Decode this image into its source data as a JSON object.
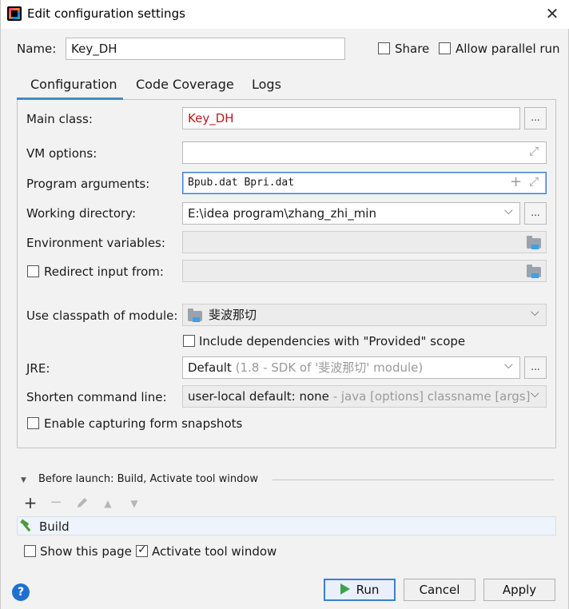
{
  "window": {
    "title": "Edit configuration settings",
    "close_glyph": "✕"
  },
  "name_row": {
    "label": "Name:",
    "value": "Key_DH",
    "share_label": "Share",
    "parallel_label": "Allow parallel run"
  },
  "tabs": [
    {
      "label": "Configuration",
      "active": true
    },
    {
      "label": "Code Coverage",
      "active": false
    },
    {
      "label": "Logs",
      "active": false
    }
  ],
  "form": {
    "main_class": {
      "label": "Main class:",
      "value": "Key_DH"
    },
    "vm_options": {
      "label": "VM options:",
      "value": ""
    },
    "program_arguments": {
      "label": "Program arguments:",
      "value": "Bpub.dat Bpri.dat"
    },
    "working_directory": {
      "label": "Working directory:",
      "value": "E:\\idea program\\zhang_zhi_min"
    },
    "environment_variables": {
      "label": "Environment variables:",
      "value": ""
    },
    "redirect_input": {
      "label": "Redirect input from:",
      "value": ""
    },
    "classpath_module": {
      "label": "Use classpath of module:",
      "value": "斐波那切"
    },
    "include_provided": {
      "label": "Include dependencies with \"Provided\" scope"
    },
    "jre": {
      "label": "JRE:",
      "value": "Default",
      "hint": "(1.8 - SDK of '斐波那切' module)"
    },
    "shorten": {
      "label": "Shorten command line:",
      "value": "user-local default: none",
      "hint": " - java [options] classname [args]"
    },
    "capture_snapshots": {
      "label": "Enable capturing form snapshots"
    }
  },
  "before_launch": {
    "header": "Before launch: Build, Activate tool window",
    "items": [
      {
        "label": "Build"
      }
    ],
    "show_page_label": "Show this page",
    "activate_label": "Activate tool window"
  },
  "buttons": {
    "run": "Run",
    "cancel": "Cancel",
    "apply": "Apply",
    "help": "?",
    "dots": "..."
  },
  "glyphs": {
    "plus": "+",
    "minus": "−",
    "up": "▲",
    "down": "▼",
    "expand": "⤢",
    "chevron": "⌵",
    "triangle": "▼"
  },
  "colors": {
    "accent": "#4a88c7",
    "error_text": "#c2151a",
    "focus": "#3b7ad9",
    "help": "#1f70d1"
  }
}
